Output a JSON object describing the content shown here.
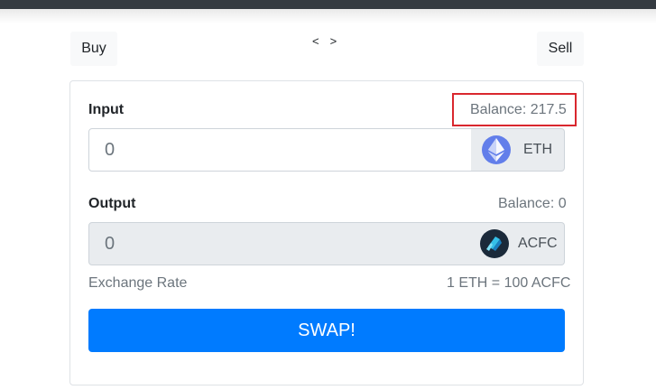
{
  "nav": {
    "buy_label": "Buy",
    "sell_label": "Sell",
    "prev_arrow": "<",
    "next_arrow": ">"
  },
  "input": {
    "label": "Input",
    "balance": "Balance: 217.5",
    "value": "0",
    "token": "ETH",
    "token_icon": "ethereum-icon"
  },
  "output": {
    "label": "Output",
    "balance": "Balance: 0",
    "value": "0",
    "token": "ACFC",
    "token_icon": "acfc-token-icon"
  },
  "exchange": {
    "label": "Exchange Rate",
    "rate": "1 ETH = 100 ACFC"
  },
  "swap": {
    "label": "SWAP!"
  },
  "colors": {
    "primary": "#007bff",
    "highlight": "#d9272e",
    "eth": "#627eea"
  }
}
